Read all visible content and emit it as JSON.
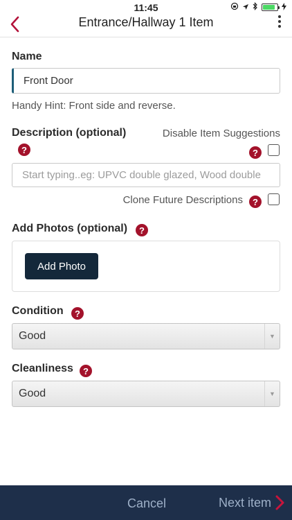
{
  "status_bar": {
    "time": "11:45",
    "battery_level": 0.85
  },
  "nav": {
    "title": "Entrance/Hallway 1 Item"
  },
  "name_section": {
    "label": "Name",
    "value": "Front Door",
    "hint": "Handy Hint: Front side and reverse."
  },
  "description_section": {
    "label": "Description (optional)",
    "disable_suggestions_label": "Disable Item Suggestions",
    "disable_suggestions_checked": false,
    "placeholder": "Start typing..eg: UPVC double glazed, Wood double",
    "clone_label": "Clone Future Descriptions",
    "clone_checked": false
  },
  "photos_section": {
    "label": "Add Photos (optional)",
    "button_label": "Add Photo"
  },
  "condition_section": {
    "label": "Condition",
    "selected": "Good"
  },
  "cleanliness_section": {
    "label": "Cleanliness",
    "selected": "Good"
  },
  "help_glyph": "?",
  "bottom_bar": {
    "cancel_label": "Cancel",
    "next_label": "Next item"
  },
  "colors": {
    "accent": "#a3122b",
    "bottom_bar": "#1e2f4a",
    "primary_button": "#14283a"
  }
}
